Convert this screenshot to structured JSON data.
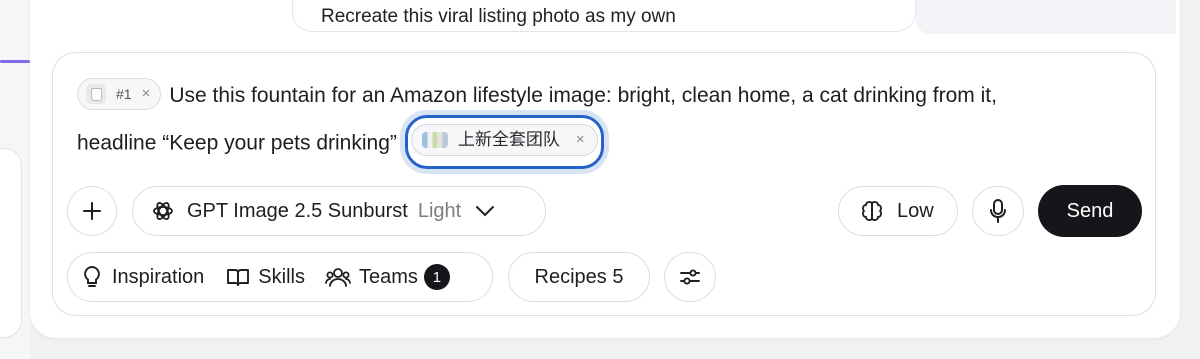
{
  "suggestion": {
    "text": "Recreate this viral listing photo as my own"
  },
  "prompt": {
    "attachment": {
      "label": "#1",
      "remove": "×"
    },
    "text_line1": "Use this fountain for an Amazon lifestyle image: bright, clean home, a cat drinking from it,",
    "text_line2": "headline “Keep your pets drinking”",
    "team_chip": {
      "label": "上新全套团队",
      "remove": "×"
    }
  },
  "toolbar": {
    "model": {
      "name": "GPT Image 2.5 Sunburst",
      "variant": "Light"
    },
    "quality": "Low",
    "send_label": "Send"
  },
  "bottom_bar": {
    "inspiration": "Inspiration",
    "skills": "Skills",
    "teams": "Teams",
    "teams_count": "1",
    "recipes": "Recipes 5"
  },
  "colors": {
    "focus_ring": "#2563c9",
    "send_bg": "#16161a",
    "accent_left": "#7c6cf0"
  },
  "icons": [
    "plus-icon",
    "openai-icon",
    "chevron-down-icon",
    "brain-icon",
    "microphone-icon",
    "lightbulb-icon",
    "book-icon",
    "people-icon",
    "sliders-icon",
    "fountain-thumbnail-icon"
  ]
}
